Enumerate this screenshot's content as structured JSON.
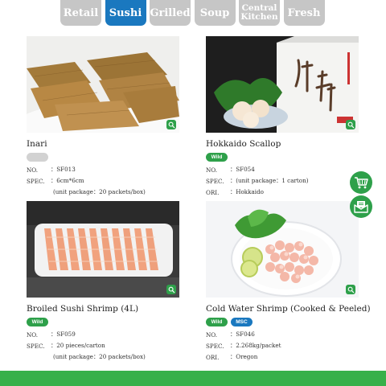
{
  "tabs": [
    {
      "label": "Retail",
      "active": false
    },
    {
      "label": "Sushi",
      "active": true
    },
    {
      "label": "Grilled",
      "active": false
    },
    {
      "label": "Soup",
      "active": false
    },
    {
      "label": "Central\nKitchen",
      "active": false
    },
    {
      "label": "Fresh",
      "active": false
    }
  ],
  "spec_labels": {
    "no": "NO.",
    "spec": "SPEC.",
    "ori": "ORI."
  },
  "products": [
    {
      "title": "Inari",
      "badges": [],
      "no": "：SF013",
      "spec": "：6cm*6cm",
      "spec_extra": "(unit package：20 packets/box)",
      "ori": ""
    },
    {
      "title": "Hokkaido Scallop",
      "badges": [
        "Wild"
      ],
      "no": "：SF054",
      "spec": "：(unit package：1 carton)",
      "spec_extra": "",
      "ori": "：Hokkaido"
    },
    {
      "title": "Broiled Sushi Shrimp (4L)",
      "badges": [
        "Wild"
      ],
      "no": "：SF059",
      "spec": "：20 pieces/carton",
      "spec_extra": "(unit package：20 packets/box)",
      "ori": ""
    },
    {
      "title": "Cold Water Shrimp (Cooked & Peeled)",
      "badges": [
        "Wild",
        "MSC"
      ],
      "no": "：SF046",
      "spec": "：2.268kg/packet",
      "spec_extra": "",
      "ori": "：Oregon"
    }
  ],
  "side_buttons": [
    "cart-icon",
    "email-icon"
  ],
  "colors": {
    "active_tab": "#1a78bf",
    "inactive_tab": "#c6c6c6",
    "accent_green": "#37b04a"
  }
}
